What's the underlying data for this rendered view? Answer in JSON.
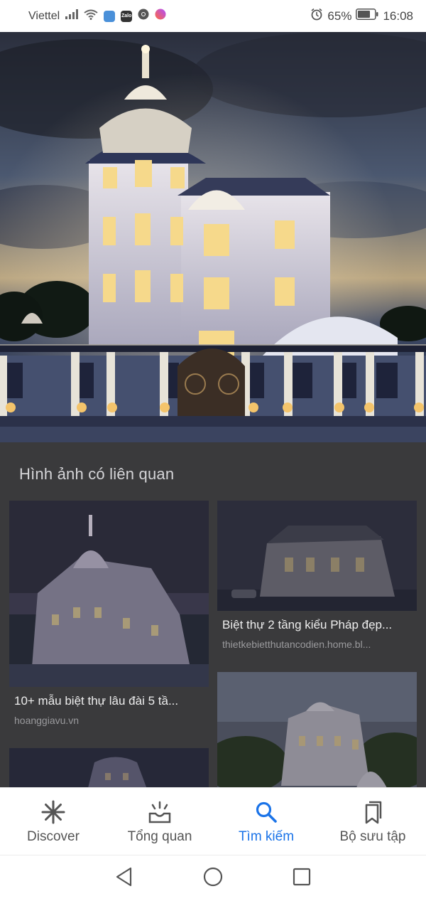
{
  "status_bar": {
    "carrier": "Viettel",
    "app_icons": [
      "signal-icon",
      "wifi-icon",
      "files-icon",
      "zalo-icon",
      "chrome-icon",
      "messenger-icon"
    ],
    "zalo_label": "Zalo",
    "battery_percent": "65%",
    "time": "16:08"
  },
  "hero": {
    "icon": "villa-night-photo"
  },
  "related": {
    "title": "Hình ảnh có liên quan",
    "cards": [
      {
        "title": "10+ mẫu biệt thự lâu đài 5 tầ...",
        "source": "hoanggiavu.vn"
      },
      {
        "title": "Biệt thự 2 tầng kiểu Pháp đẹp...",
        "source": "thietkebietthutancodien.home.bl..."
      },
      {
        "title": "",
        "source": ""
      },
      {
        "title": "",
        "source": ""
      }
    ]
  },
  "bottom_nav": {
    "items": [
      {
        "label": "Discover",
        "icon": "asterisk-icon"
      },
      {
        "label": "Tổng quan",
        "icon": "updates-icon"
      },
      {
        "label": "Tìm kiếm",
        "icon": "search-icon"
      },
      {
        "label": "Bộ sưu tập",
        "icon": "collections-icon"
      }
    ],
    "active_index": 2,
    "active_color": "#1a73e8"
  },
  "system_nav": {
    "icons": [
      "back-icon",
      "home-icon",
      "recents-icon"
    ]
  }
}
